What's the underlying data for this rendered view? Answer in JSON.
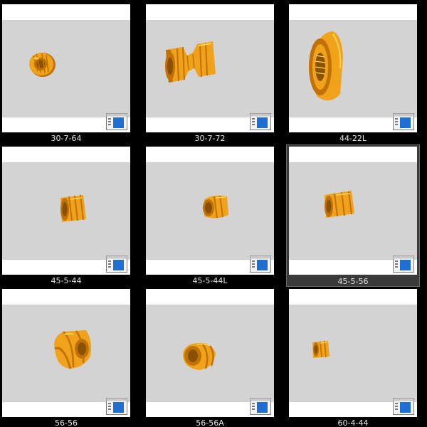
{
  "colors": {
    "background": "#000000",
    "thumb_frame": "#ffffff",
    "viewport": "#d3d3d3",
    "part_main": "#f0a21a",
    "part_shade": "#c07206",
    "part_highlight": "#ffd45a",
    "selection": "#3a3a3a",
    "icon_blue": "#1e6fd1",
    "caption_text": "#e6e6e6"
  },
  "files": [
    {
      "name": "30-7-64",
      "selected": false,
      "icon": "solidworks-part-icon"
    },
    {
      "name": "30-7-72",
      "selected": false,
      "icon": "solidworks-part-icon"
    },
    {
      "name": "44-22L",
      "selected": false,
      "icon": "solidworks-part-icon"
    },
    {
      "name": "45-5-44",
      "selected": false,
      "icon": "solidworks-part-icon"
    },
    {
      "name": "45-5-44L",
      "selected": false,
      "icon": "solidworks-part-icon"
    },
    {
      "name": "45-5-56",
      "selected": true,
      "icon": "solidworks-part-icon"
    },
    {
      "name": "56-56",
      "selected": false,
      "icon": "solidworks-part-icon"
    },
    {
      "name": "56-56A",
      "selected": false,
      "icon": "solidworks-part-icon"
    },
    {
      "name": "60-4-44",
      "selected": false,
      "icon": "solidworks-part-icon"
    }
  ]
}
